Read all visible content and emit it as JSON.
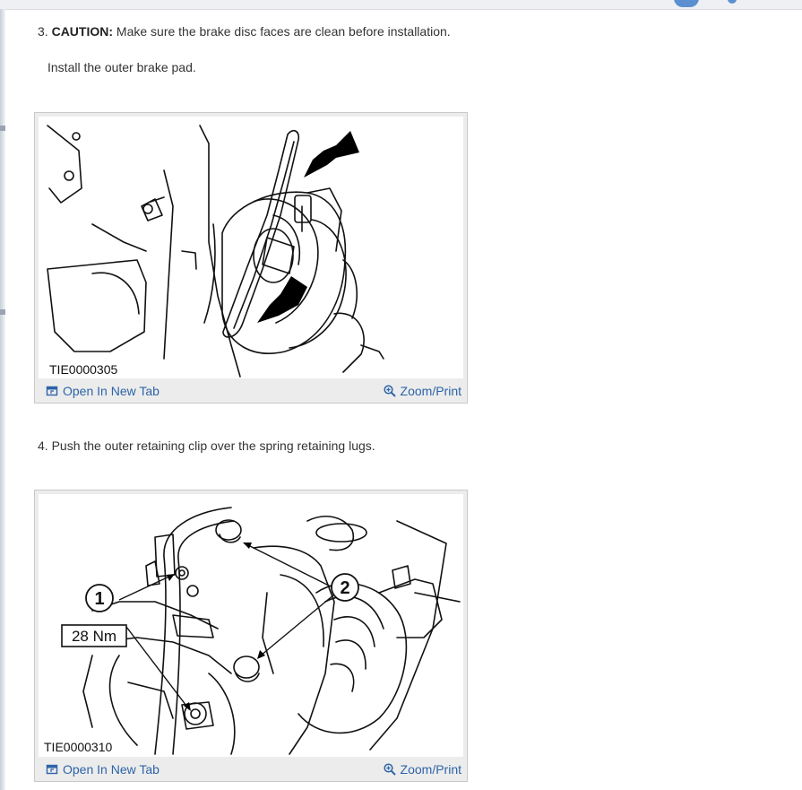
{
  "steps": [
    {
      "number": "3.",
      "caution_label": "CAUTION:",
      "caution_text": "Make sure the brake disc faces are clean before installation.",
      "instruction": "Install the outer brake pad.",
      "figure": {
        "id": "TIE0000305",
        "open_tab_label": "Open In New Tab",
        "zoom_label": "Zoom/Print"
      }
    },
    {
      "number": "4.",
      "instruction": "Push the outer retaining clip over the spring retaining lugs.",
      "figure": {
        "id": "TIE0000310",
        "callout_1": "1",
        "callout_2": "2",
        "torque_label": "28 Nm",
        "open_tab_label": "Open In New Tab",
        "zoom_label": "Zoom/Print"
      }
    }
  ],
  "colors": {
    "link": "#2d64a8",
    "text": "#333333",
    "frame": "#ececec"
  },
  "icons": {
    "open_tab": "external-window-icon",
    "zoom": "magnifier-plus-icon"
  }
}
